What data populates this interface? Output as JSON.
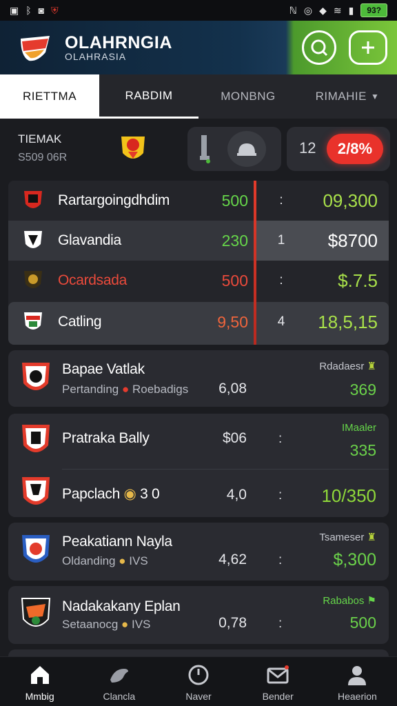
{
  "status_bar": {
    "left_icons": [
      "gallery-icon",
      "bluetooth-icon",
      "image-icon",
      "shield-icon"
    ],
    "right_icons": [
      "nfc-icon",
      "mute-icon",
      "location-icon",
      "wifi-icon",
      "signal-icon"
    ],
    "battery": "93?"
  },
  "header": {
    "title": "OLAHRNGIA",
    "subtitle": "OLAHRASIA"
  },
  "tabs": [
    {
      "label": "RIETTMA"
    },
    {
      "label": "RABDIM"
    },
    {
      "label": "MONBNG"
    },
    {
      "label": "RIMAHIE"
    }
  ],
  "summary": {
    "title": "TIEMAK",
    "subtitle": "S509 06R",
    "score": "12",
    "percent": "2/8%"
  },
  "standings": [
    {
      "name": "Rartargoingdhdim",
      "value": "500",
      "rank": ":",
      "amount": "09,300"
    },
    {
      "name": "Glavandia",
      "value": "230",
      "rank": "1",
      "amount": "$8700"
    },
    {
      "name": "Ocardsada",
      "value": "500",
      "rank": ":",
      "amount": "$.7.5"
    },
    {
      "name": "Catling",
      "value": "9,50",
      "rank": "4",
      "amount": "18,5,15"
    }
  ],
  "cards": [
    {
      "title": "Bapae Vatlak",
      "sub1": "Pertanding",
      "sub2": "Roebadigs",
      "mid": "6,08",
      "tag": "Rdadaesr",
      "money": "369"
    },
    {
      "title": "Pratraka Bally",
      "mid": "$06",
      "colon": ":",
      "tag": "IMaaler",
      "money": "335"
    },
    {
      "title": "Papclach",
      "title_extra": "3 0",
      "mid": "4,0",
      "colon": ":",
      "money": "10/350"
    },
    {
      "title": "Peakatiann Nayla",
      "sub1": "Oldanding",
      "sub2": "IVS",
      "mid": "4,62",
      "colon": ":",
      "tag": "Tsameser",
      "money": "$,300"
    },
    {
      "title": "Nadakakany Eplan",
      "sub1": "Setaanocg",
      "sub2": "IVS",
      "mid": "0,78",
      "colon": ":",
      "tag": "Rababos",
      "money": "500"
    }
  ],
  "bottom_nav": [
    {
      "label": "Mmbig",
      "icon": "home-icon"
    },
    {
      "label": "Clancla",
      "icon": "bird-icon"
    },
    {
      "label": "Naver",
      "icon": "clock-icon"
    },
    {
      "label": "Bender",
      "icon": "mail-icon"
    },
    {
      "label": "Heaerion",
      "icon": "profile-icon"
    }
  ],
  "colors": {
    "accent_green": "#66d64a",
    "accent_red": "#e9322b",
    "header_blue": "#13314c"
  }
}
